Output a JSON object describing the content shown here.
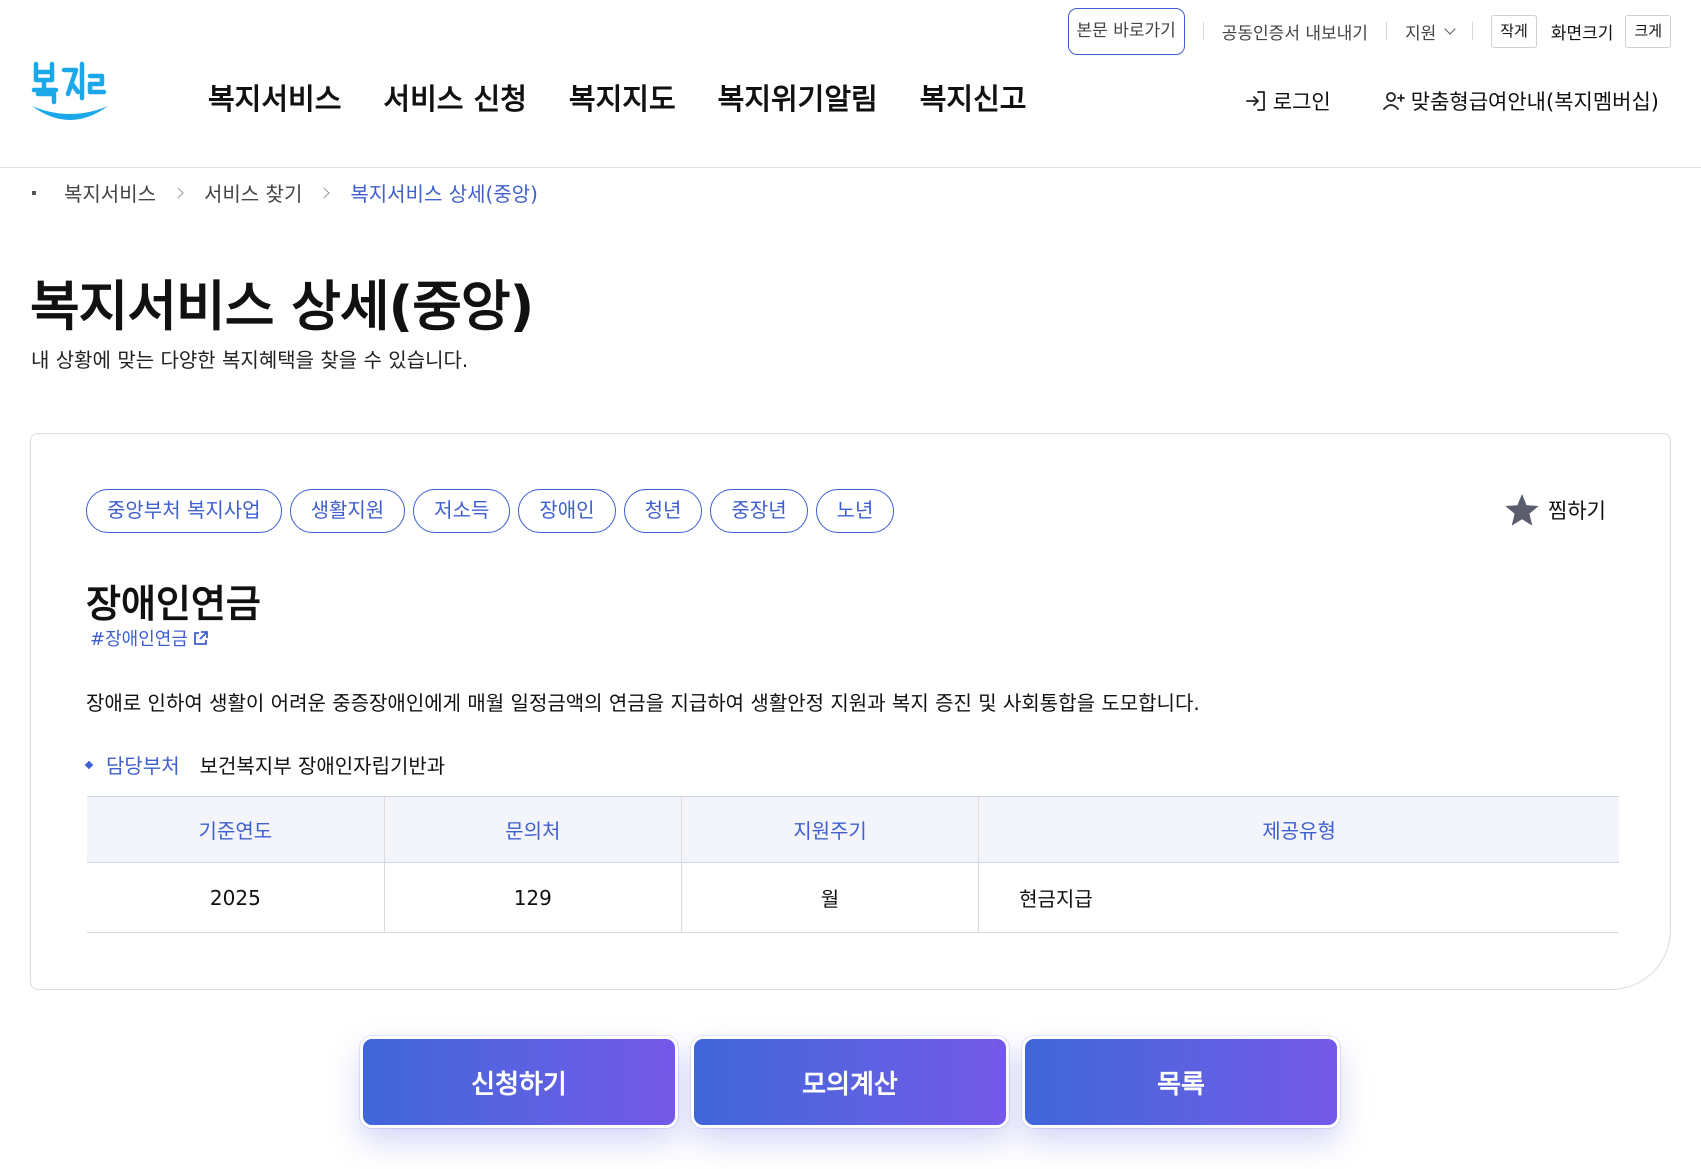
{
  "utility": {
    "skip_link": "본문 바로가기",
    "cert_export": "공동인증서 내보내기",
    "support": "지원",
    "font_small": "작게",
    "font_size_label": "화면크기",
    "font_large": "크게"
  },
  "logo": {
    "text": "복지로"
  },
  "nav": {
    "items": [
      "복지서비스",
      "서비스 신청",
      "복지지도",
      "복지위기알림",
      "복지신고"
    ]
  },
  "member": {
    "login": "로그인",
    "membership": "맞춤형급여안내(복지멤버십)"
  },
  "breadcrumb": {
    "items": [
      "복지서비스",
      "서비스 찾기",
      "복지서비스 상세(중앙)"
    ]
  },
  "page": {
    "title": "복지서비스 상세(중앙)",
    "subtitle": "내 상황에 맞는 다양한 복지혜택을 찾을 수 있습니다."
  },
  "service": {
    "tags": [
      "중앙부처 복지사업",
      "생활지원",
      "저소득",
      "장애인",
      "청년",
      "중장년",
      "노년"
    ],
    "favorite_label": "찜하기",
    "title": "장애인연금",
    "hashtag": "#장애인연금",
    "description": "장애로 인하여 생활이 어려운 중증장애인에게 매월 일정금액의 연금을 지급하여 생활안정 지원과 복지 증진 및 사회통합을 도모합니다.",
    "dept_label": "담당부처",
    "dept_value": "보건복지부 장애인자립기반과",
    "table": {
      "headers": [
        "기준연도",
        "문의처",
        "지원주기",
        "제공유형"
      ],
      "row": [
        "2025",
        "129",
        "월",
        "현금지급"
      ]
    }
  },
  "actions": {
    "apply": "신청하기",
    "simulate": "모의계산",
    "list": "목록"
  },
  "colors": {
    "accent": "#3f5fd0",
    "button_gradient_start": "#3f66d9",
    "button_gradient_end": "#7559e8",
    "logo_blue": "#1aa8e8"
  }
}
